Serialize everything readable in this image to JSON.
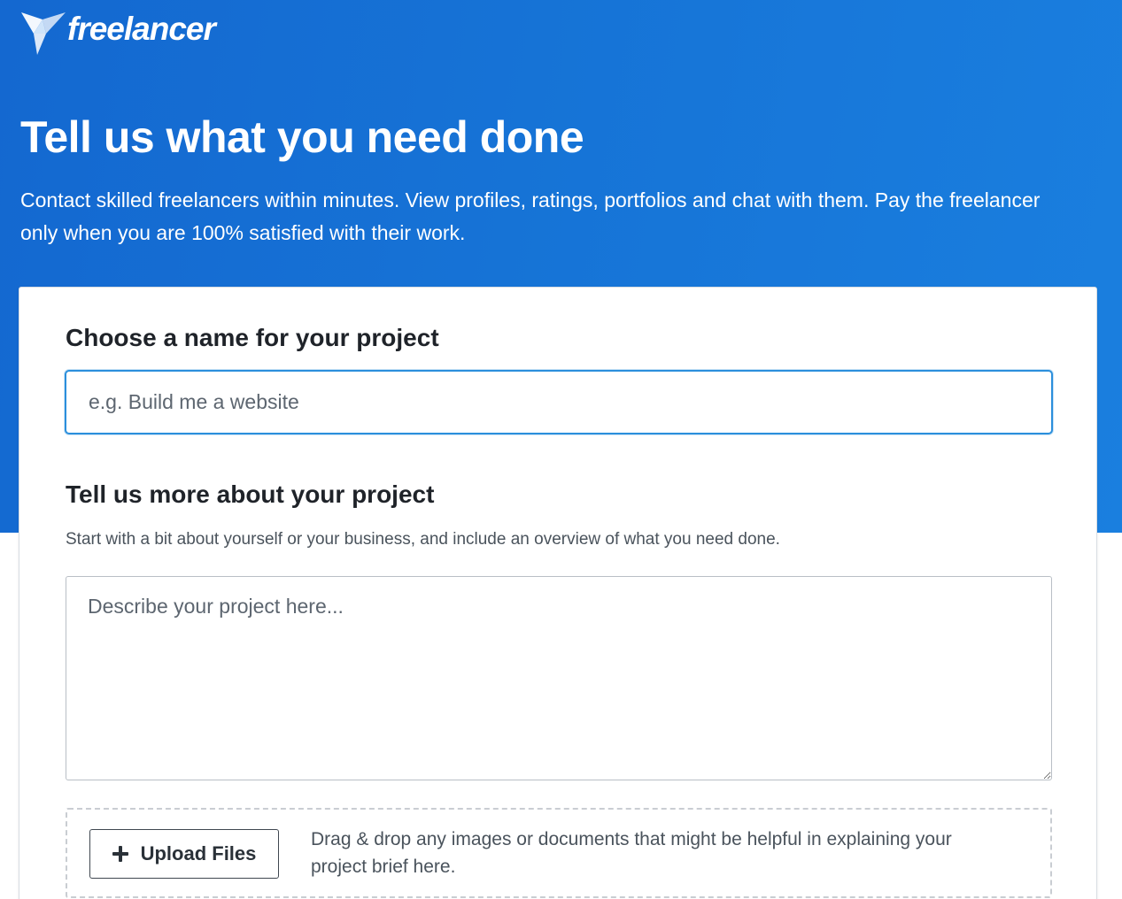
{
  "brand": {
    "name": "freelancer"
  },
  "hero": {
    "title": "Tell us what you need done",
    "subtitle": "Contact skilled freelancers within minutes. View profiles, ratings, portfolios and chat with them. Pay the freelancer only when you are 100% satisfied with their work."
  },
  "form": {
    "name_label": "Choose a name for your project",
    "name_placeholder": "e.g. Build me a website",
    "name_value": "",
    "details_label": "Tell us more about your project",
    "details_helper": "Start with a bit about yourself or your business, and include an overview of what you need done.",
    "details_placeholder": "Describe your project here...",
    "details_value": "",
    "upload_button_label": "Upload Files",
    "upload_hint": "Drag & drop any images or documents that might be helpful in explaining your project brief here."
  },
  "icons": {
    "logo": "freelancer-bird-icon",
    "upload": "plus-icon"
  },
  "colors": {
    "hero_blue": "#1673d6",
    "focus_border": "#2b8fdc",
    "heading_text": "#1f2329"
  }
}
